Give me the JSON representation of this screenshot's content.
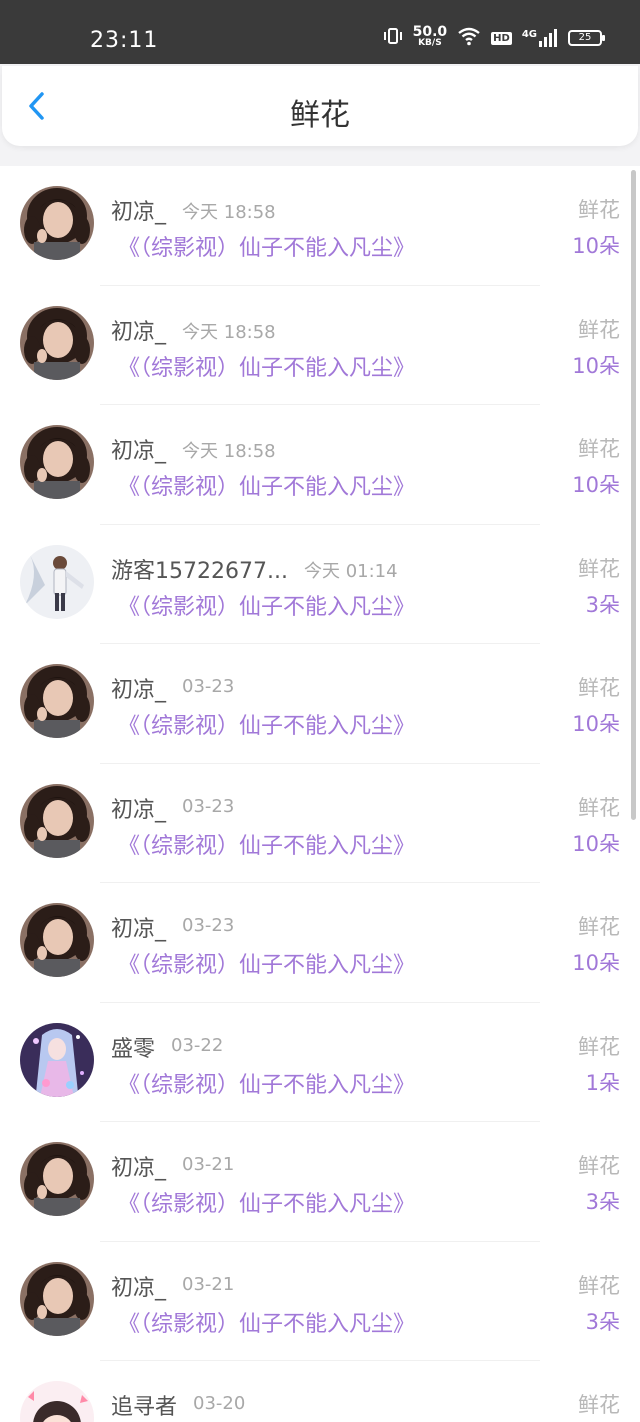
{
  "status_bar": {
    "time": "23:11",
    "speed_value": "50.0",
    "speed_unit": "KB/S",
    "hd": "HD",
    "network": "4G",
    "battery": "25"
  },
  "header": {
    "title": "鲜花",
    "back_icon": "chevron-left-icon"
  },
  "colors": {
    "accent_purple": "#a178d8",
    "back_blue": "#2196f3",
    "status_bar_bg": "#3a3a3a"
  },
  "list": [
    {
      "name": "初凉_",
      "time": "今天 18:58",
      "book": "《（综影视）仙子不能入凡尘》",
      "label": "鲜花",
      "count": "10朵",
      "avatar": "girl-portrait"
    },
    {
      "name": "初凉_",
      "time": "今天 18:58",
      "book": "《（综影视）仙子不能入凡尘》",
      "label": "鲜花",
      "count": "10朵",
      "avatar": "girl-portrait"
    },
    {
      "name": "初凉_",
      "time": "今天 18:58",
      "book": "《（综影视）仙子不能入凡尘》",
      "label": "鲜花",
      "count": "10朵",
      "avatar": "girl-portrait"
    },
    {
      "name": "游客15722677...",
      "time": "今天 01:14",
      "book": "《（综影视）仙子不能入凡尘》",
      "label": "鲜花",
      "count": "3朵",
      "avatar": "anime-boy"
    },
    {
      "name": "初凉_",
      "time": "03-23",
      "book": "《（综影视）仙子不能入凡尘》",
      "label": "鲜花",
      "count": "10朵",
      "avatar": "girl-portrait"
    },
    {
      "name": "初凉_",
      "time": "03-23",
      "book": "《（综影视）仙子不能入凡尘》",
      "label": "鲜花",
      "count": "10朵",
      "avatar": "girl-portrait"
    },
    {
      "name": "初凉_",
      "time": "03-23",
      "book": "《（综影视）仙子不能入凡尘》",
      "label": "鲜花",
      "count": "10朵",
      "avatar": "girl-portrait"
    },
    {
      "name": "盛零",
      "time": "03-22",
      "book": "《（综影视）仙子不能入凡尘》",
      "label": "鲜花",
      "count": "1朵",
      "avatar": "anime-girl"
    },
    {
      "name": "初凉_",
      "time": "03-21",
      "book": "《（综影视）仙子不能入凡尘》",
      "label": "鲜花",
      "count": "3朵",
      "avatar": "girl-portrait"
    },
    {
      "name": "初凉_",
      "time": "03-21",
      "book": "《（综影视）仙子不能入凡尘》",
      "label": "鲜花",
      "count": "3朵",
      "avatar": "girl-portrait"
    },
    {
      "name": "追寻者",
      "time": "03-20",
      "book": "",
      "label": "鲜花",
      "count": "",
      "avatar": "anime-chibi"
    }
  ]
}
